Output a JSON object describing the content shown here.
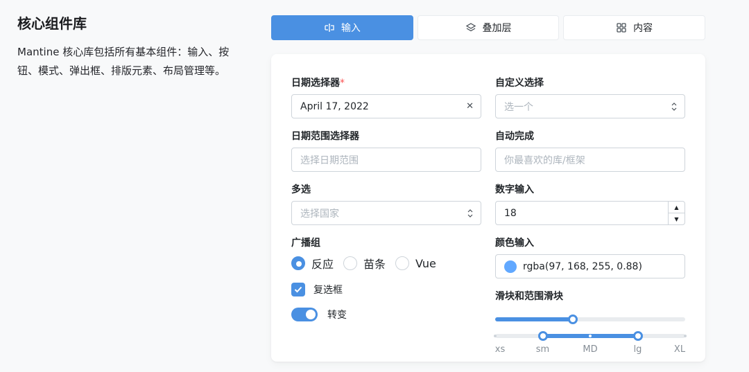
{
  "intro": {
    "title": "核心组件库",
    "description": "Mantine 核心库包括所有基本组件：输入、按钮、模式、弹出框、排版元素、布局管理等。"
  },
  "tabs": [
    {
      "label": "输入",
      "icon": "input-cursor-icon",
      "active": true
    },
    {
      "label": "叠加层",
      "icon": "layers-icon",
      "active": false
    },
    {
      "label": "内容",
      "icon": "grid-icon",
      "active": false
    }
  ],
  "form": {
    "date_picker": {
      "label": "日期选择器",
      "required_mark": "*",
      "value": "April 17, 2022"
    },
    "custom_select": {
      "label": "自定义选择",
      "placeholder": "选一个"
    },
    "date_range": {
      "label": "日期范围选择器",
      "placeholder": "选择日期范围"
    },
    "autocomplete": {
      "label": "自动完成",
      "placeholder": "你最喜欢的库/框架"
    },
    "multiselect": {
      "label": "多选",
      "placeholder": "选择国家"
    },
    "number_input": {
      "label": "数字输入",
      "value": "18"
    },
    "radio_group": {
      "label": "广播组",
      "options": [
        {
          "label": "反应",
          "checked": true
        },
        {
          "label": "苗条",
          "checked": false
        },
        {
          "label": "Vue",
          "checked": false
        }
      ]
    },
    "checkbox": {
      "label": "复选框",
      "checked": true
    },
    "switch": {
      "label": "转变",
      "on": true
    },
    "color_input": {
      "label": "颜色输入",
      "value": "rgba(97, 168, 255, 0.88)",
      "swatch": "#61a8ff"
    },
    "sliders": {
      "label": "滑块和范围滑块",
      "slider_value": 0.41,
      "range_values": [
        0.25,
        0.75
      ],
      "marks": [
        "xs",
        "sm",
        "MD",
        "lg",
        "XL"
      ]
    }
  },
  "colors": {
    "accent": "#4a90e2",
    "border": "#ced4da",
    "background": "#f8f9fa"
  }
}
